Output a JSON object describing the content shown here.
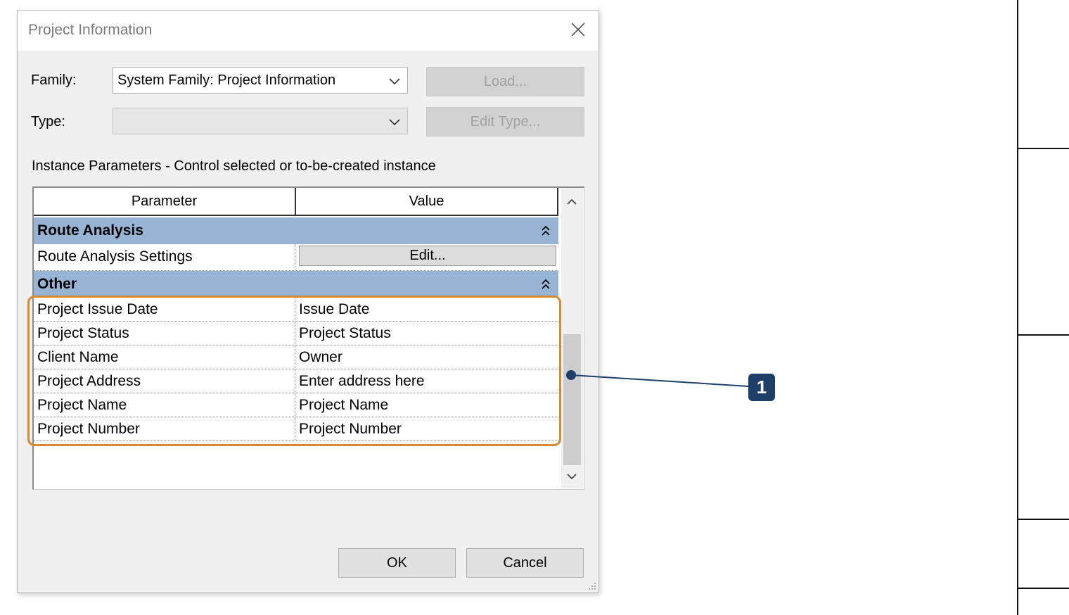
{
  "window": {
    "title": "Project Information"
  },
  "family": {
    "label": "Family:",
    "value": "System Family: Project Information"
  },
  "type": {
    "label": "Type:",
    "value": ""
  },
  "buttons": {
    "load": "Load...",
    "edit_type": "Edit Type...",
    "ok": "OK",
    "cancel": "Cancel"
  },
  "instance_label": "Instance Parameters - Control selected or to-be-created instance",
  "grid": {
    "headers": {
      "parameter": "Parameter",
      "value": "Value"
    },
    "groups": [
      {
        "title": "Route Analysis",
        "rows": [
          {
            "parameter": "Route Analysis Settings",
            "value": "Edit..."
          }
        ]
      },
      {
        "title": "Other",
        "rows": [
          {
            "parameter": "Project Issue Date",
            "value": "Issue Date"
          },
          {
            "parameter": "Project Status",
            "value": "Project Status"
          },
          {
            "parameter": "Client Name",
            "value": "Owner"
          },
          {
            "parameter": "Project Address",
            "value": "Enter address here"
          },
          {
            "parameter": "Project Name",
            "value": "Project Name"
          },
          {
            "parameter": "Project Number",
            "value": "Project Number"
          }
        ]
      }
    ]
  },
  "callout": {
    "number": "1"
  },
  "colors": {
    "group_header": "#98b4d4",
    "highlight": "#d98a2e",
    "badge": "#1f3f6b"
  }
}
